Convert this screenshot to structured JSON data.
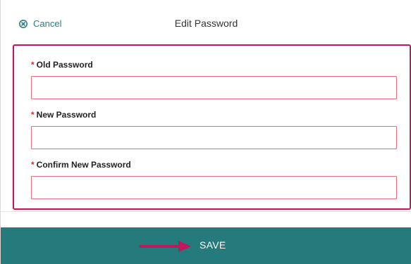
{
  "header": {
    "cancel_label": "Cancel",
    "title": "Edit Password"
  },
  "form": {
    "required_marker": "*",
    "fields": [
      {
        "label": "Old Password",
        "value": ""
      },
      {
        "label": "New Password",
        "value": ""
      },
      {
        "label": "Confirm New Password",
        "value": ""
      }
    ]
  },
  "footer": {
    "save_label": "SAVE"
  },
  "icons": {
    "cancel": "close-circle-icon",
    "annotation": "arrow-right-icon"
  },
  "colors": {
    "accent_teal": "#257a7c",
    "highlight_magenta": "#c2185b",
    "required_red": "#d32f2f",
    "input_border": "#e0707a"
  }
}
